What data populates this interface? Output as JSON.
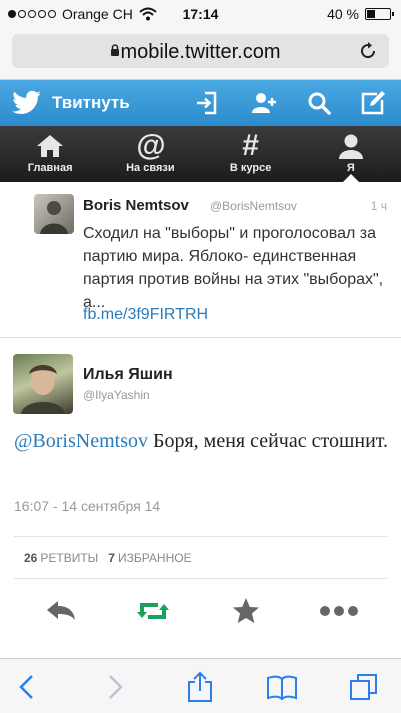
{
  "status_bar": {
    "carrier": "Orange CH",
    "time": "17:14",
    "battery": "40 %",
    "battery_level": 0.4
  },
  "browser": {
    "url": "mobile.twitter.com"
  },
  "twitter_header": {
    "brand": "Твитнуть"
  },
  "tabs": [
    {
      "label": "Главная",
      "icon": "home-icon"
    },
    {
      "label": "На связи",
      "icon": "at-icon"
    },
    {
      "label": "В курсе",
      "icon": "hash-icon"
    },
    {
      "label": "Я",
      "icon": "person-icon"
    }
  ],
  "quoted_tweet": {
    "name": "Boris Nemtsov",
    "handle": "@BorisNemtsov",
    "time": "1 ч",
    "text": "Сходил на \"выборы\" и проголосовал за партию мира. Яблоко- единственная партия против войны на этих \"выборах\", а...",
    "link": "fb.me/3f9FIRTRH"
  },
  "tweet": {
    "name": "Илья Яшин",
    "handle": "@IlyaYashin",
    "mention": "@BorisNemtsov",
    "text": " Боря, меня сейчас стошнит.",
    "date": "16:07 - 14 сентября 14",
    "retweets_count": "26",
    "retweets_label": "РЕТВИТЫ",
    "favorites_count": "7",
    "favorites_label": "ИЗБРАННОЕ"
  },
  "colors": {
    "twitter_blue": "#2b8bcc",
    "link": "#2b7bb9",
    "retweet_green": "#19a35a"
  }
}
